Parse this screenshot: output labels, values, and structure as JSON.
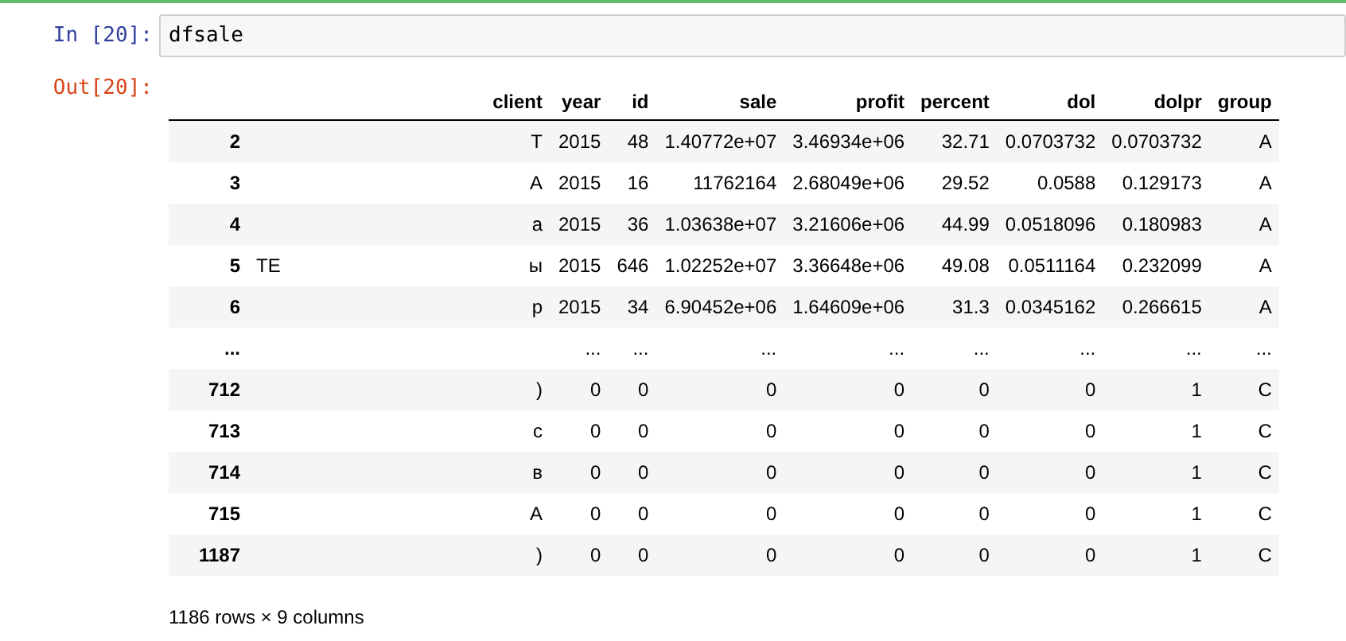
{
  "input_cell": {
    "prompt": "In [20]:",
    "code": "dfsale"
  },
  "output_cell": {
    "prompt": "Out[20]:",
    "table": {
      "columns": [
        "",
        "client",
        "year",
        "id",
        "sale",
        "profit",
        "percent",
        "dol",
        "dolpr",
        "group"
      ],
      "rows": [
        {
          "client_left": "",
          "cells": [
            "2",
            "Т",
            "2015",
            "48",
            "1.40772e+07",
            "3.46934e+06",
            "32.71",
            "0.0703732",
            "0.0703732",
            "A"
          ]
        },
        {
          "client_left": "",
          "cells": [
            "3",
            "А",
            "2015",
            "16",
            "11762164",
            "2.68049e+06",
            "29.52",
            "0.0588",
            "0.129173",
            "A"
          ]
        },
        {
          "client_left": "",
          "cells": [
            "4",
            "а",
            "2015",
            "36",
            "1.03638e+07",
            "3.21606e+06",
            "44.99",
            "0.0518096",
            "0.180983",
            "A"
          ]
        },
        {
          "client_left": "ТЕ",
          "cells": [
            "5",
            "ы",
            "2015",
            "646",
            "1.02252e+07",
            "3.36648e+06",
            "49.08",
            "0.0511164",
            "0.232099",
            "A"
          ]
        },
        {
          "client_left": "",
          "cells": [
            "6",
            "р",
            "2015",
            "34",
            "6.90452e+06",
            "1.64609e+06",
            "31.3",
            "0.0345162",
            "0.266615",
            "A"
          ]
        },
        {
          "client_left": "",
          "cells": [
            "...",
            "",
            "...",
            "...",
            "...",
            "...",
            "...",
            "...",
            "...",
            "..."
          ]
        },
        {
          "client_left": "",
          "cells": [
            "712",
            ")",
            "0",
            "0",
            "0",
            "0",
            "0",
            "0",
            "1",
            "C"
          ]
        },
        {
          "client_left": "",
          "cells": [
            "713",
            "с",
            "0",
            "0",
            "0",
            "0",
            "0",
            "0",
            "1",
            "C"
          ]
        },
        {
          "client_left": "",
          "cells": [
            "714",
            "в",
            "0",
            "0",
            "0",
            "0",
            "0",
            "0",
            "1",
            "C"
          ]
        },
        {
          "client_left": "",
          "cells": [
            "715",
            "А",
            "0",
            "0",
            "0",
            "0",
            "0",
            "0",
            "1",
            "C"
          ]
        },
        {
          "client_left": "",
          "cells": [
            "1187",
            ")",
            "0",
            "0",
            "0",
            "0",
            "0",
            "0",
            "1",
            "C"
          ]
        }
      ]
    },
    "footer": "1186 rows × 9 columns"
  }
}
